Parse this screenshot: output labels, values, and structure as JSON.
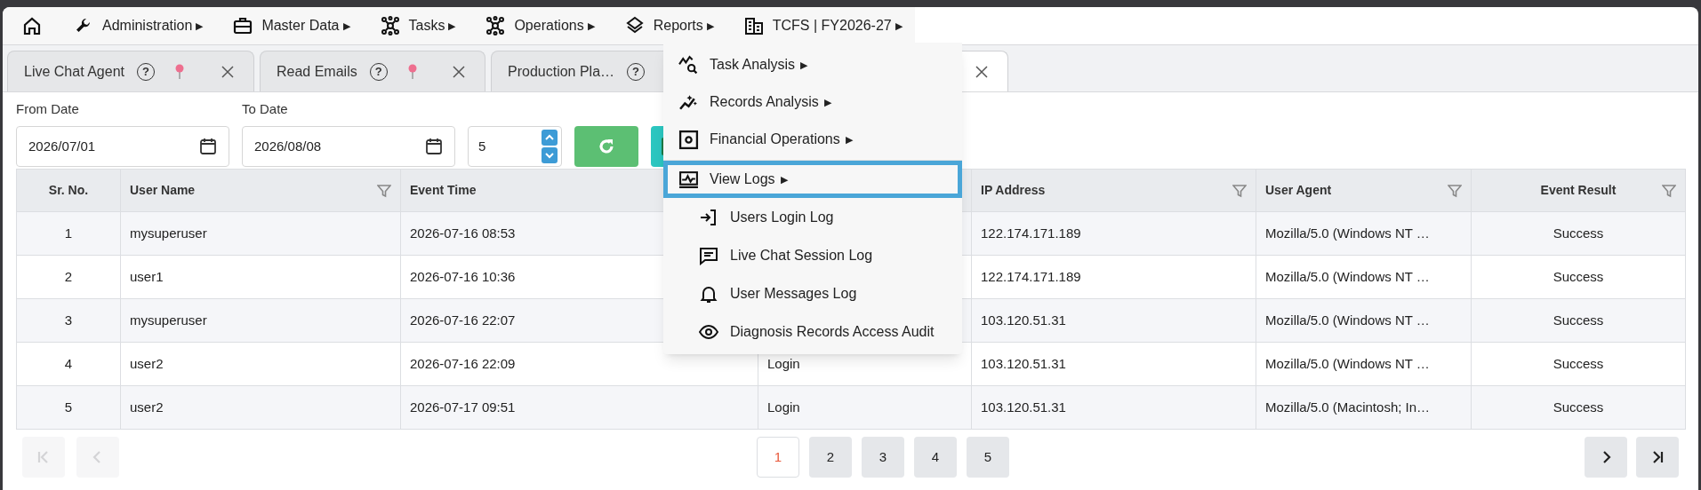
{
  "nav": [
    {
      "label": "Administration",
      "caret": "▶"
    },
    {
      "label": "Master Data",
      "caret": "▶"
    },
    {
      "label": "Tasks",
      "caret": "▶"
    },
    {
      "label": "Operations",
      "caret": "▶"
    },
    {
      "label": "Reports",
      "caret": "▶"
    },
    {
      "label": "TCFS | FY2026-27",
      "caret": "▶"
    }
  ],
  "tabs": [
    {
      "label": "Live Chat Agent",
      "help": "?",
      "selected": false,
      "pinned": true
    },
    {
      "label": "Read Emails",
      "help": "?",
      "selected": false,
      "pinned": true
    },
    {
      "label": "Production Pla…",
      "help": "?",
      "selected": false
    },
    {
      "selected": true,
      "pinned": false
    }
  ],
  "filters": [
    {
      "label": "From Date",
      "value": "2026/07/01"
    },
    {
      "label": "To Date",
      "value": "2026/08/08"
    }
  ],
  "page_size": "5",
  "menu": {
    "items": [
      {
        "label": "Task Analysis",
        "caret": "▶"
      },
      {
        "label": "Records Analysis",
        "caret": "▶"
      },
      {
        "label": "Financial Operations",
        "caret": "▶"
      },
      {
        "label": "View Logs",
        "caret": "▶",
        "selected": true,
        "children": [
          {
            "label": "Users Login Log"
          },
          {
            "label": "Live Chat Session Log"
          },
          {
            "label": "User Messages Log"
          },
          {
            "label": "Diagnosis Records Access Audit"
          }
        ]
      }
    ]
  },
  "table": {
    "columns": [
      {
        "label": "Sr. No."
      },
      {
        "label": "User Name",
        "filter": true
      },
      {
        "label": "Event Time"
      },
      {},
      {
        "label": "IP Address",
        "filter": true
      },
      {
        "label": "User Agent",
        "filter": true
      },
      {
        "label": "Event Result",
        "filter": true
      }
    ],
    "rows": [
      {
        "cells": [
          "1",
          "mysuperuser",
          "2026-07-16 08:53",
          null,
          "122.174.171.189",
          "Mozilla/5.0 (Windows NT …",
          "Success"
        ]
      },
      {
        "cells": [
          "2",
          "user1",
          "2026-07-16 10:36",
          null,
          "122.174.171.189",
          "Mozilla/5.0 (Windows NT …",
          "Success"
        ]
      },
      {
        "cells": [
          "3",
          "mysuperuser",
          "2026-07-16 22:07",
          null,
          "103.120.51.31",
          "Mozilla/5.0 (Windows NT …",
          "Success"
        ]
      },
      {
        "cells": [
          "4",
          "user2",
          "2026-07-16 22:09",
          "Login",
          "103.120.51.31",
          "Mozilla/5.0 (Windows NT …",
          "Success"
        ]
      },
      {
        "cells": [
          "5",
          "user2",
          "2026-07-17 09:51",
          "Login",
          "103.120.51.31",
          "Mozilla/5.0 (Macintosh; In…",
          "Success"
        ]
      }
    ]
  },
  "pagination": {
    "nav_buttons": [
      {
        "kind": "first",
        "disabled": true
      },
      {
        "kind": "previous",
        "disabled": true
      },
      {
        "kind": "next",
        "disabled": false
      },
      {
        "kind": "last",
        "disabled": false
      }
    ],
    "pages": [
      {
        "label": "1",
        "selected": true
      },
      {
        "label": "2",
        "selected": false
      },
      {
        "label": "3",
        "selected": false
      },
      {
        "label": "4",
        "selected": false
      },
      {
        "label": "5",
        "selected": false
      }
    ]
  }
}
